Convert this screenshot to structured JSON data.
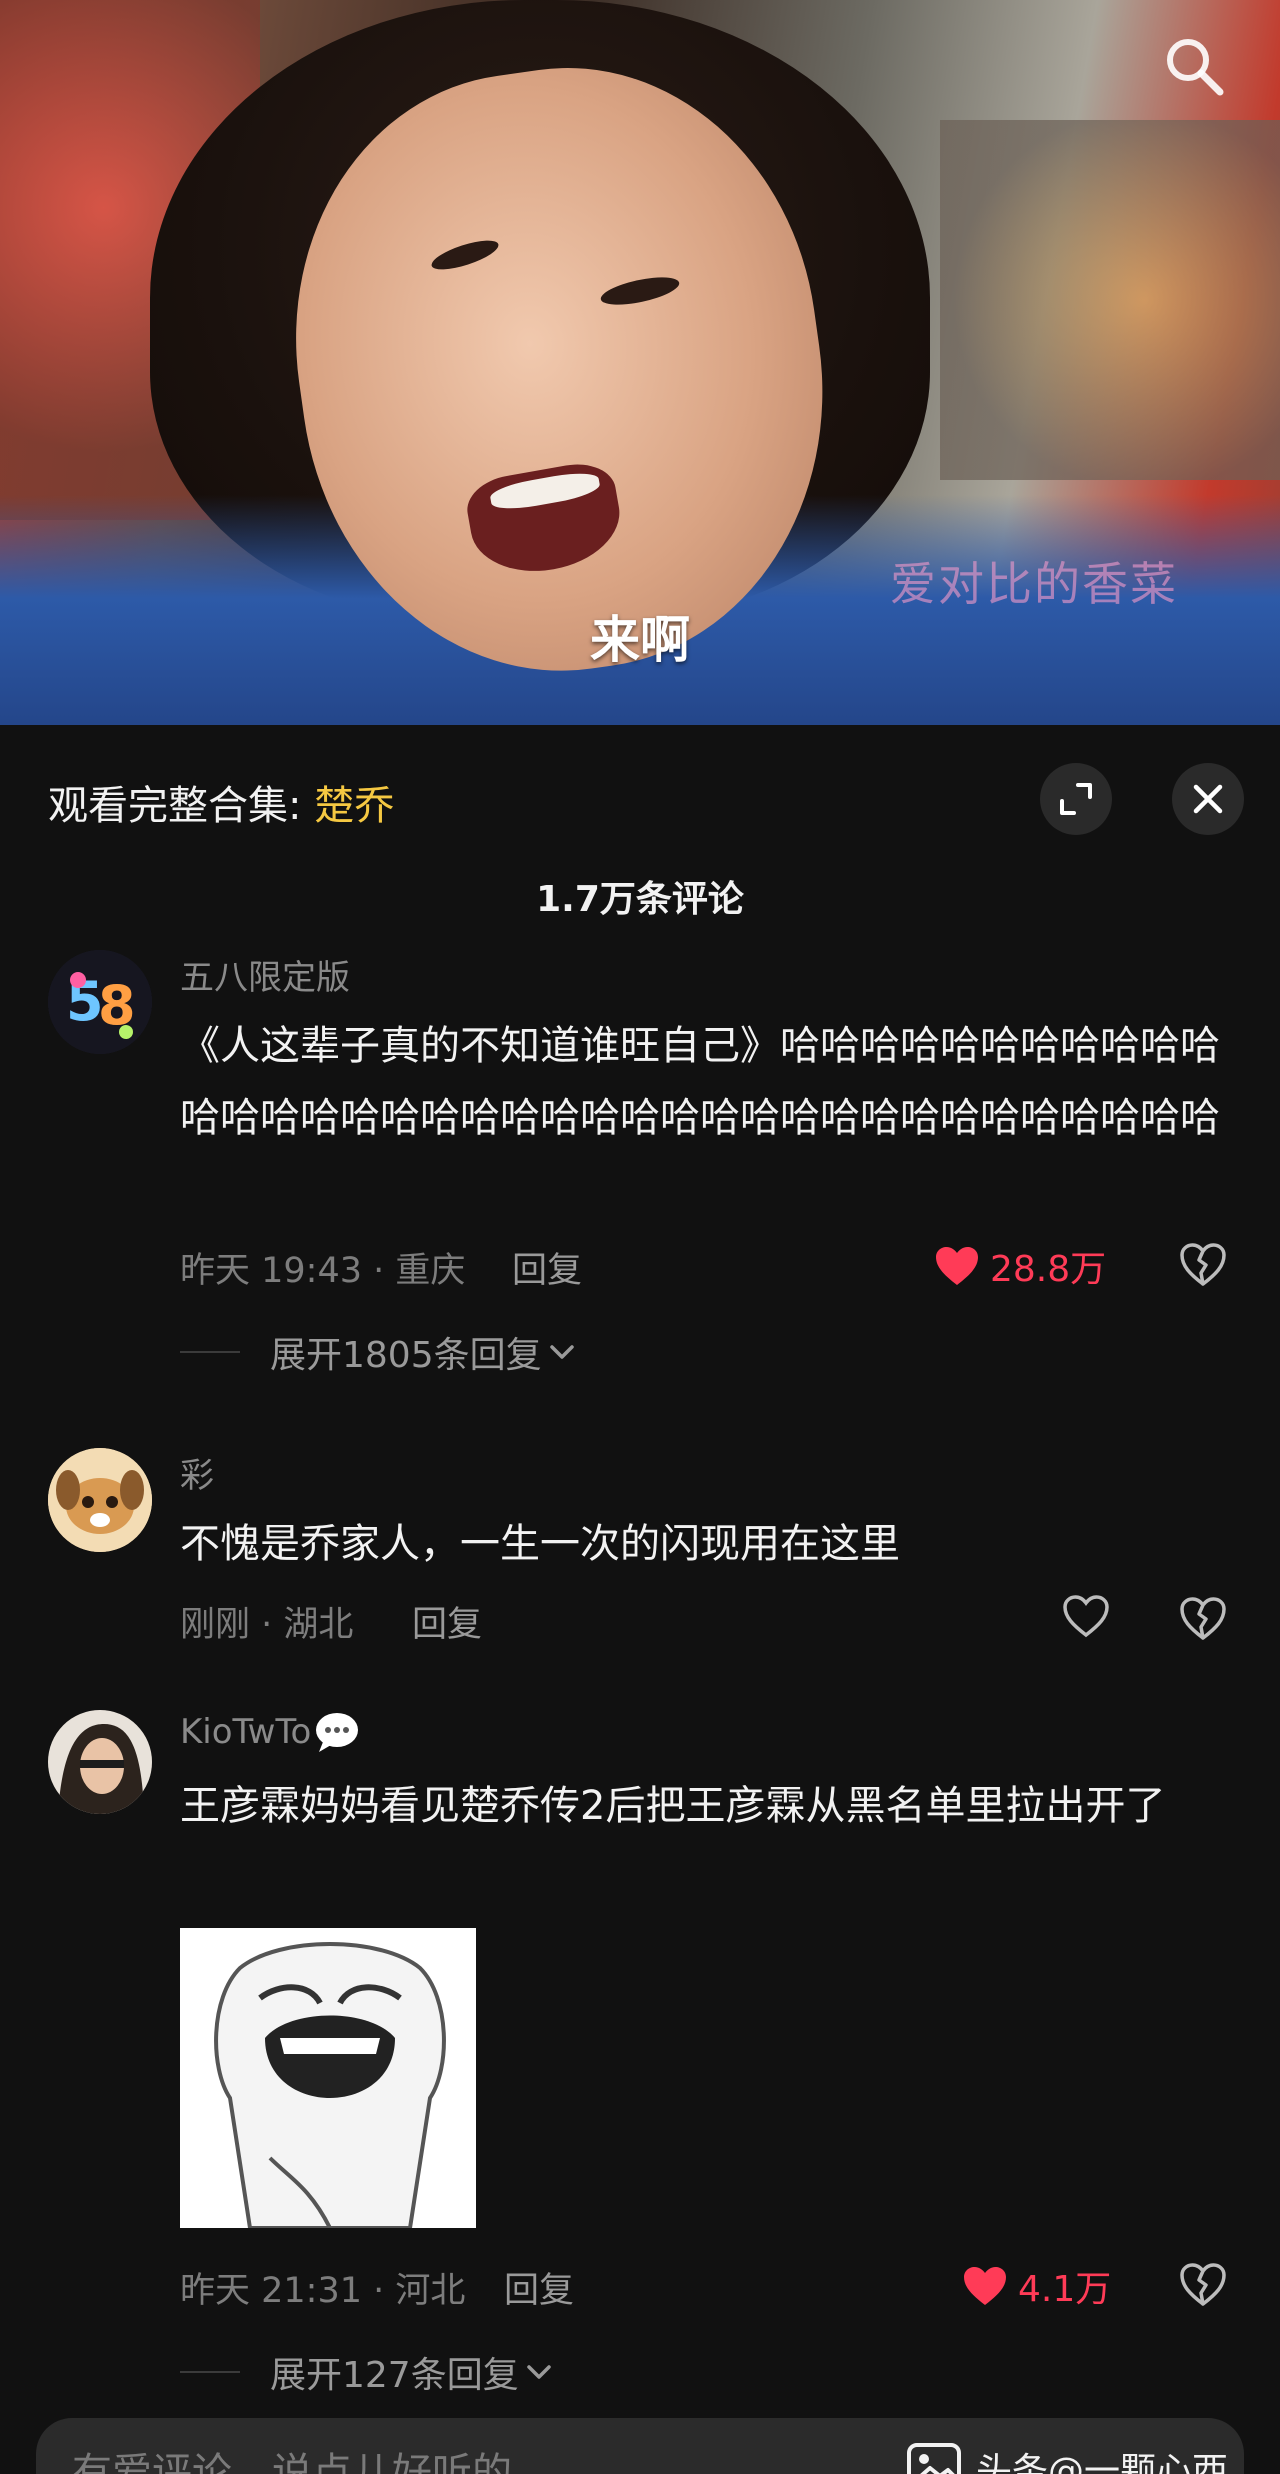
{
  "video": {
    "subtitle": "来啊",
    "watermark": "爱对比的香菜"
  },
  "panel": {
    "collection_prefix": "观看完整合集: ",
    "collection_name": "楚乔",
    "comment_count": "1.7万条评论"
  },
  "comments": [
    {
      "username": "五八限定版",
      "text": "《人这辈子真的不知道谁旺自己》哈哈哈哈哈哈哈哈哈哈哈哈哈哈哈哈哈哈哈哈哈哈哈哈哈哈哈哈哈哈哈哈哈哈哈哈哈",
      "meta": "昨天 19:43 · 重庆",
      "reply_label": "回复",
      "likes": "28.8万",
      "liked": true,
      "expand_label": "展开1805条回复"
    },
    {
      "username": "彩",
      "text": "不愧是乔家人，一生一次的闪现用在这里",
      "meta": "刚刚 · 湖北",
      "reply_label": "回复",
      "likes": "",
      "liked": false
    },
    {
      "username": "KioTwTo",
      "text": "王彦霖妈妈看见楚乔传2后把王彦霖从黑名单里拉出开了",
      "meta": "昨天 21:31 · 河北",
      "reply_label": "回复",
      "likes": "4.1万",
      "liked": true,
      "expand_label": "展开127条回复"
    }
  ],
  "input": {
    "placeholder": "有爱评论，说点儿好听的",
    "source_tag": "头条@一颗心西柚"
  },
  "colors": {
    "background": "#111111",
    "accent_like": "#ff3b57",
    "highlight": "#f5c842"
  }
}
